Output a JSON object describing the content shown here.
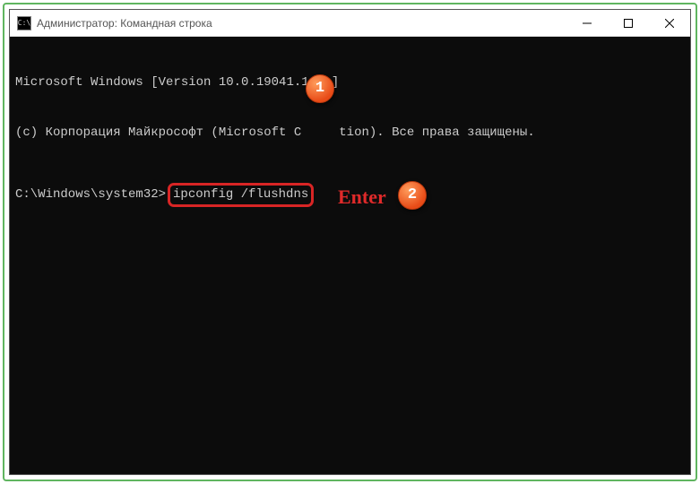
{
  "titlebar": {
    "icon_label": "C:\\",
    "title": "Администратор: Командная строка"
  },
  "console": {
    "line1": "Microsoft Windows [Version 10.0.19041.1",
    "line1_tail": "]",
    "line2": "(c) Корпорация Майкрософт (Microsoft C",
    "line2_tail": "tion). Все права защищены.",
    "prompt": "C:\\Windows\\system32>",
    "command": "ipconfig /flushdns"
  },
  "annotations": {
    "bubble1": "1",
    "bubble2": "2",
    "enter_label": "Enter"
  }
}
